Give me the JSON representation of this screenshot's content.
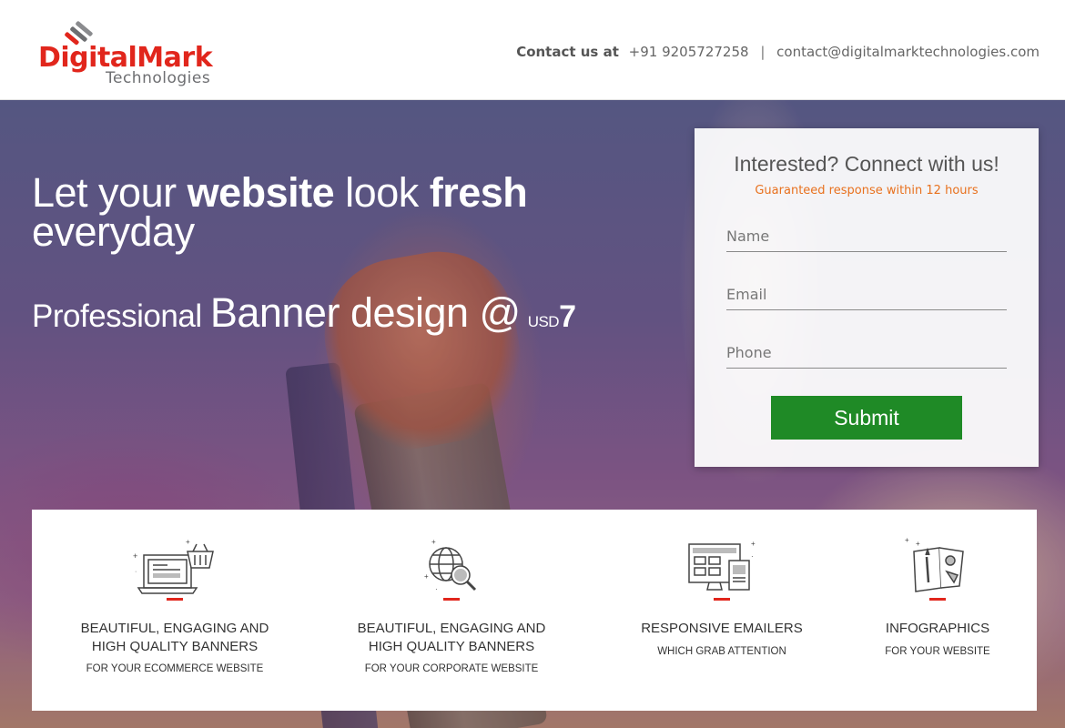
{
  "header": {
    "logo": {
      "word": "DigitalMark",
      "sub": "Technologies"
    },
    "contact": {
      "label": "Contact us at",
      "phone": "+91 9205727258",
      "separator": "|",
      "email": "contact@digitalmarktechnologies.com"
    }
  },
  "hero": {
    "headline": {
      "part1": "Let your ",
      "bold1": "website",
      "part2": " look ",
      "bold2": "fresh",
      "part3": "everyday"
    },
    "offer": {
      "p1": "Professional ",
      "p2": "Banner design @",
      "currency": "USD",
      "amount": "7"
    }
  },
  "form": {
    "title": "Interested? Connect with us!",
    "subtitle": "Guaranteed response within 12 hours",
    "name_placeholder": "Name",
    "email_placeholder": "Email",
    "phone_placeholder": "Phone",
    "submit_label": "Submit"
  },
  "features": [
    {
      "icon": "laptop-shopping-basket-icon",
      "title_line1": "BEAUTIFUL, ENGAGING AND",
      "title_line2": "HIGH QUALITY BANNERS",
      "sub": "FOR YOUR ECOMMERCE WEBSITE"
    },
    {
      "icon": "globe-magnifier-icon",
      "title_line1": "BEAUTIFUL, ENGAGING AND",
      "title_line2": "HIGH QUALITY BANNERS",
      "sub": "FOR YOUR CORPORATE WEBSITE"
    },
    {
      "icon": "devices-email-icon",
      "title_line1": "RESPONSIVE EMAILERS",
      "title_line2": "",
      "sub": "WHICH GRAB ATTENTION"
    },
    {
      "icon": "infographic-sheets-icon",
      "title_line1": "INFOGRAPHICS",
      "title_line2": "",
      "sub": "FOR YOUR WEBSITE"
    }
  ],
  "colors": {
    "brand": "#e1261c",
    "accent": "#e8711e",
    "submit": "#1f8a26"
  }
}
